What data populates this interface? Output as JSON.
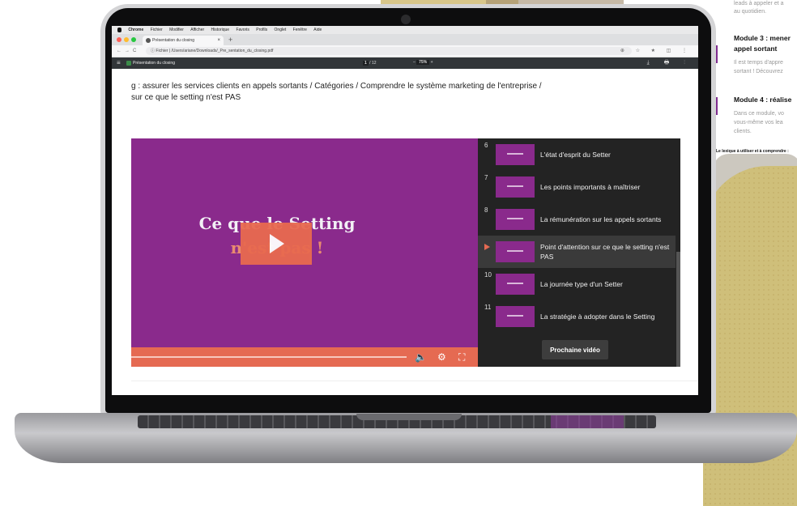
{
  "side_page": {
    "text_top_1": "leads à appeler et a",
    "text_top_2": "au quotidien.",
    "module3_title_1": "Module 3 : mener",
    "module3_title_2": "appel sortant",
    "module3_text_1": "Il est temps d'appre",
    "module3_text_2": "sortant ! Découvrez",
    "module4_title": "Module 4 : réalise",
    "module4_text_1": "Dans ce module, vo",
    "module4_text_2": "vous-même vos lea",
    "module4_text_3": "clients.",
    "footer": "Le lexique à utiliser et à comprendre :"
  },
  "mac_menu": [
    "Chrome",
    "Fichier",
    "Modifier",
    "Afficher",
    "Historique",
    "Favoris",
    "Profils",
    "Onglet",
    "Fenêtre",
    "Aide"
  ],
  "browser": {
    "tab_title": "Présentation du closing",
    "tab_close": "×",
    "new_tab": "+",
    "url": "Fichier | /Users/ariane/Downloads/_Pre_sentation_du_closing.pdf",
    "nav": {
      "back": "←",
      "forward": "→",
      "reload": "C",
      "info": "ⓘ"
    },
    "addr_icons": "⊕ ☆ ★ ◫ ⋮"
  },
  "pdf": {
    "title": "Présentation du closing",
    "menu": "≡",
    "page_current": "1",
    "page_total": "/ 12",
    "zoom": "75%",
    "zoom_minus": "–",
    "zoom_plus": "+",
    "right_icons": "⤓ 🖶 ⋮"
  },
  "breadcrumb": {
    "line1": "g : assurer les services clients en appels sortants / Catégories / Comprendre le système marketing de l'entreprise /",
    "line2": "sur ce que le setting n'est PAS"
  },
  "video": {
    "title_line1": "Ce que le Setting",
    "title_line2": "n'est pas !",
    "volume_icon": "🔈",
    "settings_icon": "⚙",
    "fullscreen_icon": "⛶",
    "progress_fraction": 0.01
  },
  "playlist": {
    "items": [
      {
        "num": "6",
        "label": "L'état d'esprit du Setter"
      },
      {
        "num": "7",
        "label": "Les points importants à maîtriser"
      },
      {
        "num": "8",
        "label": "La rémunération sur les appels sortants"
      },
      {
        "num": "",
        "label": "Point d'attention sur ce que le setting n'est PAS",
        "active": true
      },
      {
        "num": "10",
        "label": "La journée type d'un Setter"
      },
      {
        "num": "11",
        "label": "La stratégie à adopter dans le Setting"
      }
    ],
    "next_label": "Prochaine vidéo"
  },
  "colors": {
    "video_purple": "#8a2a8c",
    "accent_orange": "#e56a52",
    "playlist_bg": "#232323"
  }
}
